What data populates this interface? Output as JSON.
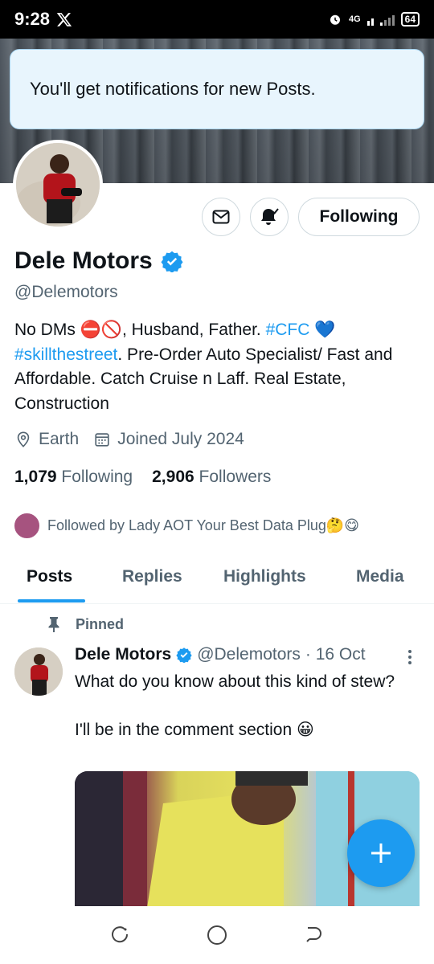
{
  "status_bar": {
    "time": "9:28",
    "network": "4G",
    "battery": "64"
  },
  "toast": {
    "message": "You'll get notifications for new Posts."
  },
  "profile": {
    "display_name": "Dele Motors",
    "handle": "@Delemotors",
    "verified": true,
    "bio": {
      "part1": "No DMs ⛔🚫, Husband, Father. ",
      "hashtag1": "#CFC",
      "heart": " 💙",
      "hashtag2": "#skillthestreet",
      "part2": ". Pre-Order Auto Specialist/ Fast and Affordable. Catch Cruise n Laff. Real Estate, Construction"
    },
    "location": "Earth",
    "joined": "Joined July 2024",
    "following_count": "1,079",
    "following_label": "Following",
    "followers_count": "2,906",
    "followers_label": "Followers",
    "followed_by": "Followed by Lady AOT Your Best Data Plug🤔😋"
  },
  "actions": {
    "follow_label": "Following"
  },
  "tabs": [
    {
      "label": "Posts",
      "active": true
    },
    {
      "label": "Replies",
      "active": false
    },
    {
      "label": "Highlights",
      "active": false
    },
    {
      "label": "Media",
      "active": false
    }
  ],
  "pinned_post": {
    "pinned_label": "Pinned",
    "author_name": "Dele Motors",
    "author_handle": "@Delemotors",
    "date": "· 16 Oct",
    "text": "What do you know about this kind of stew?\n\nI'll be in the comment section 😀"
  },
  "colors": {
    "accent": "#1d9bf0",
    "text": "#0f1419",
    "muted": "#536471",
    "toast_bg": "#e8f5fd"
  },
  "icons": [
    "x-logo-icon",
    "alarm-icon",
    "signal-icon",
    "battery-icon",
    "mail-icon",
    "bell-check-icon",
    "verified-badge-icon",
    "location-pin-icon",
    "calendar-icon",
    "pin-icon",
    "more-vertical-icon",
    "plus-icon",
    "nav-back-icon",
    "nav-home-icon",
    "nav-recents-icon"
  ]
}
